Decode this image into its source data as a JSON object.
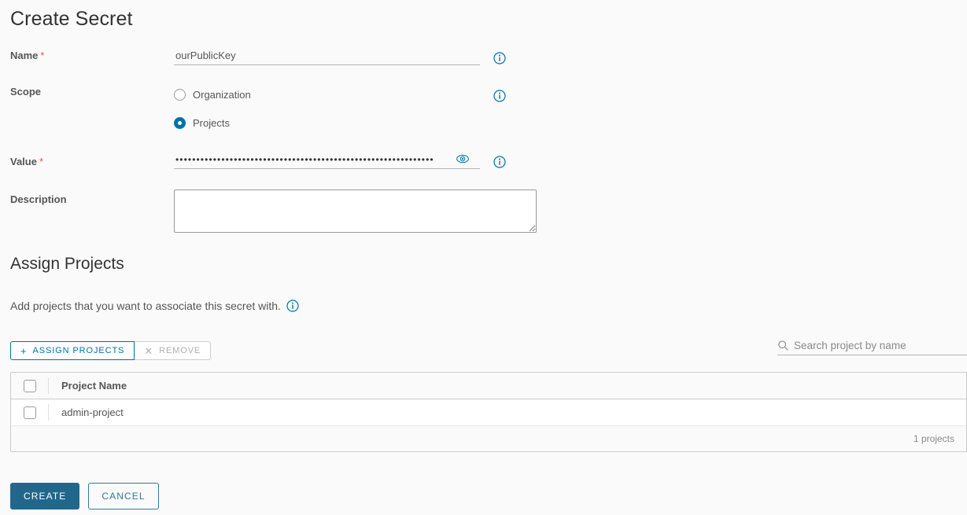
{
  "page": {
    "title": "Create Secret"
  },
  "form": {
    "name": {
      "label": "Name",
      "required_marker": "*",
      "value": "ourPublicKey",
      "placeholder": ""
    },
    "scope": {
      "label": "Scope",
      "options": [
        {
          "label": "Organization",
          "selected": false
        },
        {
          "label": "Projects",
          "selected": true
        }
      ]
    },
    "value": {
      "label": "Value",
      "required_marker": "*",
      "masked_value": "••••••••••••••••••••••••••••••••••••••••••••••••••••••••••••••",
      "reveal_icon": "eye-icon"
    },
    "description": {
      "label": "Description",
      "value": "",
      "placeholder": ""
    },
    "info_icon": "info-icon"
  },
  "assign_projects": {
    "section_title": "Assign Projects",
    "helper_text": "Add projects that you want to associate this secret with.",
    "helper_info_icon": "info-icon",
    "toolbar": {
      "assign_label": "ASSIGN PROJECTS",
      "assign_icon": "plus-icon",
      "remove_label": "REMOVE",
      "remove_icon": "close-icon",
      "remove_disabled": true
    },
    "search": {
      "placeholder": "Search project by name",
      "value": "",
      "icon": "search-icon"
    },
    "table": {
      "columns": [
        "Project Name"
      ],
      "rows": [
        {
          "project_name": "admin-project",
          "selected": false
        }
      ],
      "footer_count": "1 projects"
    }
  },
  "actions": {
    "create_label": "CREATE",
    "cancel_label": "CANCEL"
  },
  "colors": {
    "accent": "#0072a3",
    "primary_button": "#21678c",
    "required_star": "#c92100",
    "page_background": "#fafafa",
    "text": "#565656"
  }
}
